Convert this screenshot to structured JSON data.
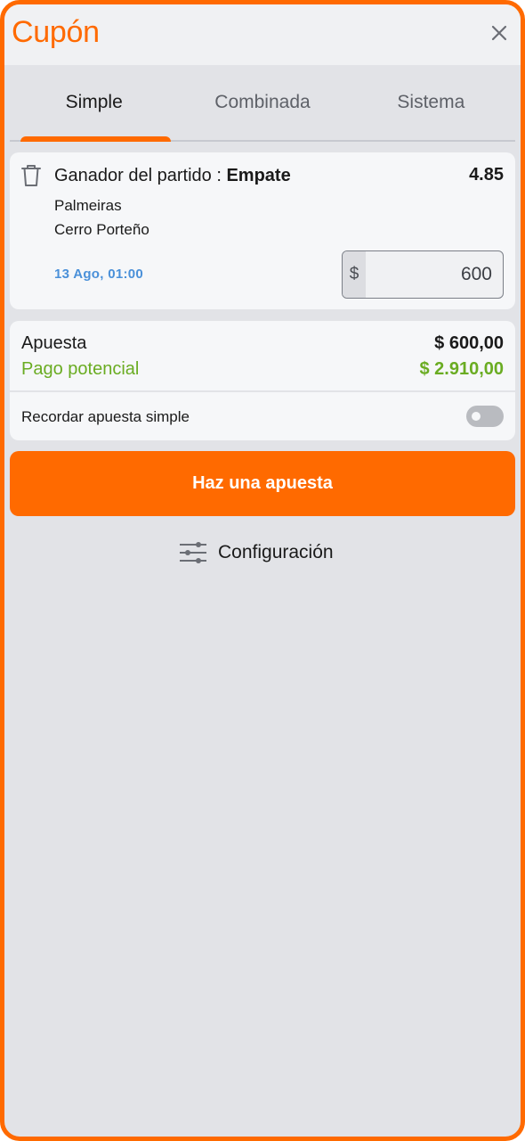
{
  "header": {
    "title": "Cupón",
    "close_icon": "close-icon"
  },
  "tabs": [
    {
      "label": "Simple",
      "active": true
    },
    {
      "label": "Combinada",
      "active": false
    },
    {
      "label": "Sistema",
      "active": false
    }
  ],
  "bet": {
    "market_prefix": "Ganador del partido : ",
    "selection": "Empate",
    "odds": "4.85",
    "team_home": "Palmeiras",
    "team_away": "Cerro Porteño",
    "date": "13 Ago, 01:00",
    "stake_prefix": "$",
    "stake_value": "600"
  },
  "summary": {
    "stake_label": "Apuesta",
    "stake_value": "$ 600,00",
    "payout_label": "Pago potencial",
    "payout_value": "$ 2.910,00",
    "remember_label": "Recordar apuesta simple",
    "remember_enabled": false
  },
  "actions": {
    "place_bet_label": "Haz una apuesta",
    "settings_label": "Configuración"
  },
  "colors": {
    "accent": "#ff6a00",
    "payout": "#6aac22",
    "date": "#4a90d9",
    "background": "#e2e3e7"
  }
}
